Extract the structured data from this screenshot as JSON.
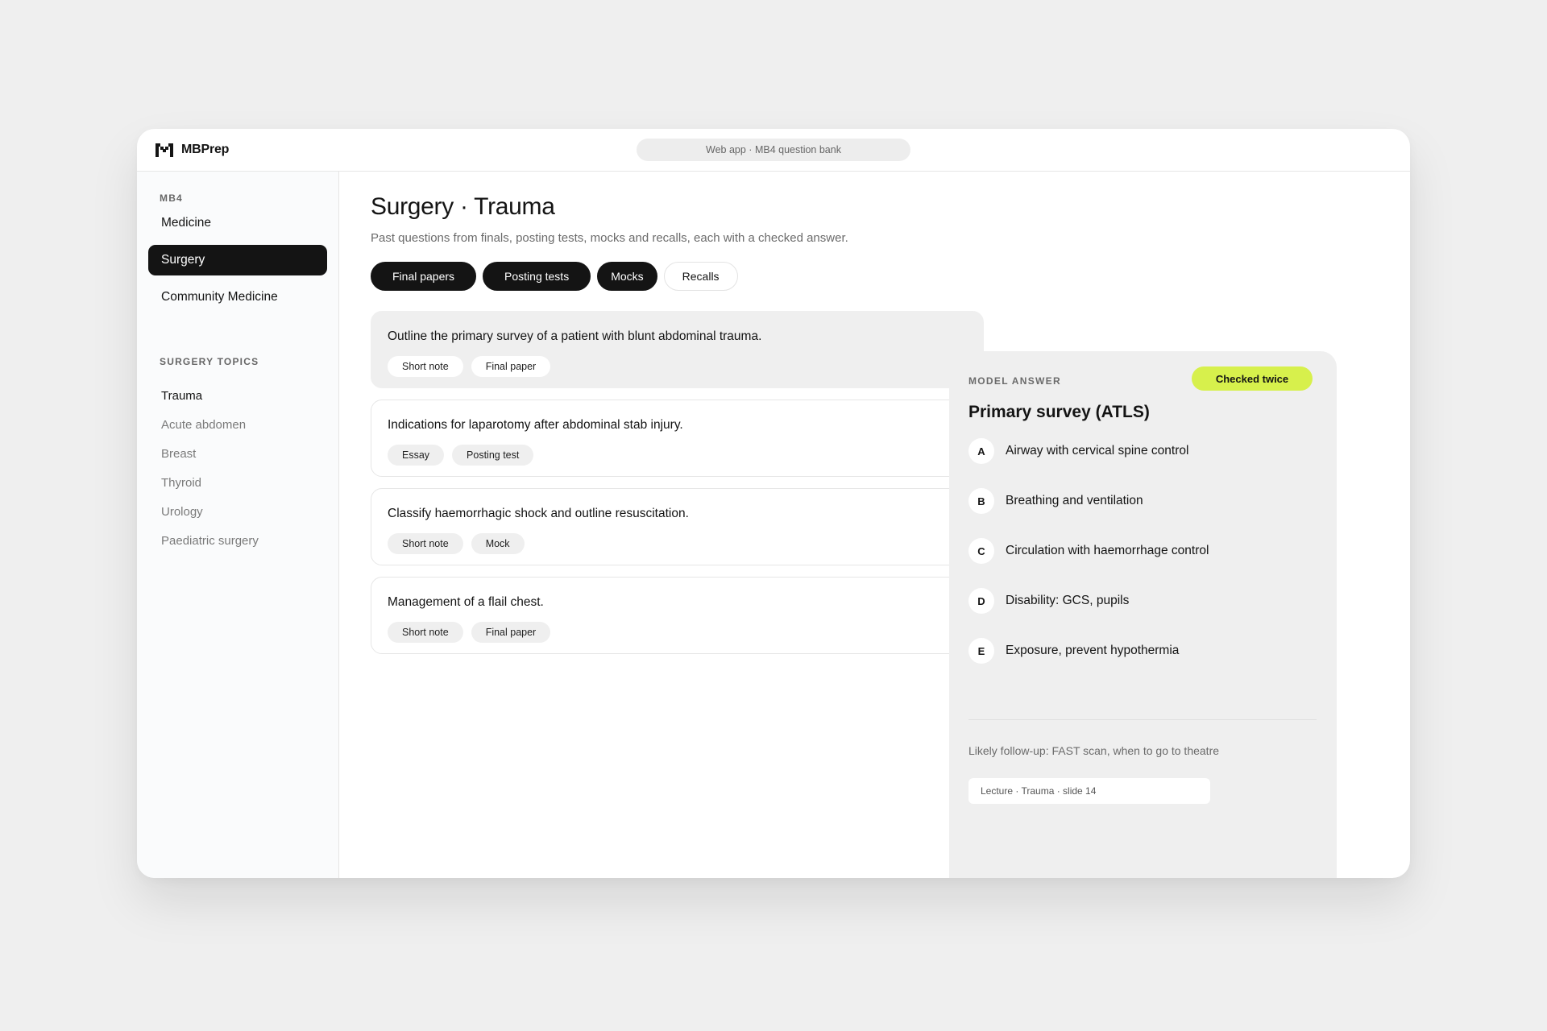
{
  "app": {
    "name": "MBPrep",
    "url_label": "Web app · MB4 question bank"
  },
  "sidebar": {
    "section_label": "MB4",
    "items": [
      {
        "label": "Medicine",
        "active": false
      },
      {
        "label": "Surgery",
        "active": true
      },
      {
        "label": "Community Medicine",
        "active": false
      }
    ],
    "topics_label": "SURGERY TOPICS",
    "topics": [
      {
        "label": "Trauma",
        "active": true
      },
      {
        "label": "Acute abdomen",
        "active": false
      },
      {
        "label": "Breast",
        "active": false
      },
      {
        "label": "Thyroid",
        "active": false
      },
      {
        "label": "Urology",
        "active": false
      },
      {
        "label": "Paediatric surgery",
        "active": false
      }
    ]
  },
  "main": {
    "title": "Surgery · Trauma",
    "subtitle": "Past questions from finals, posting tests, mocks and recalls, each with a checked answer.",
    "filters": [
      {
        "label": "Final papers",
        "active": true
      },
      {
        "label": "Posting tests",
        "active": true
      },
      {
        "label": "Mocks",
        "active": true
      },
      {
        "label": "Recalls",
        "active": false
      }
    ],
    "questions": [
      {
        "title": "Outline the primary survey of a patient with blunt abdominal trauma.",
        "tags": [
          "Short note",
          "Final paper"
        ],
        "selected": true
      },
      {
        "title": "Indications for laparotomy after abdominal stab injury.",
        "tags": [
          "Essay",
          "Posting test"
        ],
        "selected": false
      },
      {
        "title": "Classify haemorrhagic shock and outline resuscitation.",
        "tags": [
          "Short note",
          "Mock"
        ],
        "selected": false
      },
      {
        "title": "Management of a flail chest.",
        "tags": [
          "Short note",
          "Final paper"
        ],
        "selected": false
      }
    ]
  },
  "answer": {
    "kicker": "MODEL ANSWER",
    "badge": "Checked twice",
    "title": "Primary survey (ATLS)",
    "steps": [
      {
        "letter": "A",
        "text": "Airway with cervical spine control"
      },
      {
        "letter": "B",
        "text": "Breathing and ventilation"
      },
      {
        "letter": "C",
        "text": "Circulation with haemorrhage control"
      },
      {
        "letter": "D",
        "text": "Disability: GCS, pupils"
      },
      {
        "letter": "E",
        "text": "Exposure, prevent hypothermia"
      }
    ],
    "followup": "Likely follow-up: FAST scan, when to go to theatre",
    "source": "Lecture · Trauma · slide 14"
  },
  "colors": {
    "accent": "#d7f04c",
    "active": "#141414",
    "background": "#efefef"
  }
}
